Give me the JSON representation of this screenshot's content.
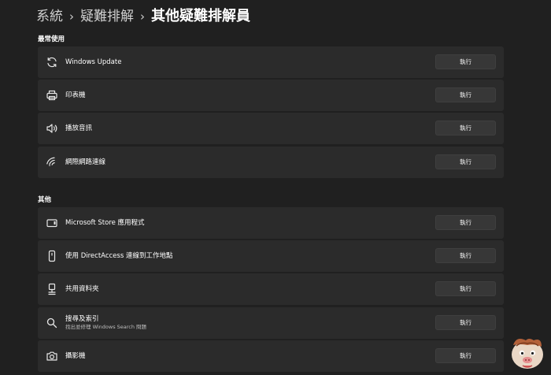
{
  "breadcrumb": {
    "items": [
      "系統",
      "疑難排解",
      "其他疑難排解員"
    ],
    "separator": "›"
  },
  "sections": {
    "most_used": {
      "title": "最常使用"
    },
    "other": {
      "title": "其他"
    }
  },
  "rows": [
    {
      "title": "Windows Update",
      "subtitle": "",
      "icon": "refresh-icon",
      "button": "執行"
    },
    {
      "title": "印表機",
      "subtitle": "",
      "icon": "printer-icon",
      "button": "執行"
    },
    {
      "title": "播放音訊",
      "subtitle": "",
      "icon": "speaker-icon",
      "button": "執行"
    },
    {
      "title": "網際網路連線",
      "subtitle": "",
      "icon": "wifi-icon",
      "button": "執行"
    },
    {
      "title": "Microsoft Store 應用程式",
      "subtitle": "",
      "icon": "app-window-icon",
      "button": "執行"
    },
    {
      "title": "使用 DirectAccess 連線到工作地點",
      "subtitle": "",
      "icon": "phone-icon",
      "button": "執行"
    },
    {
      "title": "共用資料夾",
      "subtitle": "",
      "icon": "network-folder-icon",
      "button": "執行"
    },
    {
      "title": "搜尋及索引",
      "subtitle": "找出並修理 Windows Search 問題",
      "icon": "search-icon",
      "button": "執行"
    },
    {
      "title": "攝影機",
      "subtitle": "",
      "icon": "camera-icon",
      "button": "執行"
    }
  ],
  "colors": {
    "background": "#202020",
    "card": "#2b2b2b",
    "button": "#373737",
    "text": "#ffffff"
  }
}
